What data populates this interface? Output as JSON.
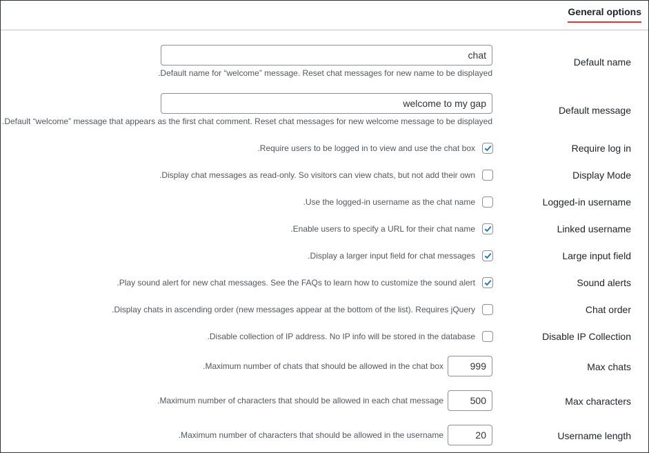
{
  "tabs": {
    "active_label": "General options"
  },
  "fields": {
    "default_name": {
      "label": "Default name",
      "value": "chat",
      "description": ".Default name for “welcome” message. Reset chat messages for new name to be displayed"
    },
    "default_message": {
      "label": "Default message",
      "value": "welcome to my gap",
      "description": ".Default “welcome” message that appears as the first chat comment. Reset chat messages for new welcome message to be displayed"
    },
    "require_login": {
      "label": "Require log in",
      "checked": true,
      "description": ".Require users to be logged in to view and use the chat box"
    },
    "display_mode": {
      "label": "Display Mode",
      "checked": false,
      "description": ".Display chat messages as read-only. So visitors can view chats, but not add their own"
    },
    "loggedin_username": {
      "label": "Logged-in username",
      "checked": false,
      "description": ".Use the logged-in username as the chat name"
    },
    "linked_username": {
      "label": "Linked username",
      "checked": true,
      "description": ".Enable users to specify a URL for their chat name"
    },
    "large_input": {
      "label": "Large input field",
      "checked": true,
      "description": ".Display a larger input field for chat messages"
    },
    "sound_alerts": {
      "label": "Sound alerts",
      "checked": true,
      "description": ".Play sound alert for new chat messages. See the FAQs to learn how to customize the sound alert"
    },
    "chat_order": {
      "label": "Chat order",
      "checked": false,
      "description": ".Display chats in ascending order (new messages appear at the bottom of the list). Requires jQuery"
    },
    "disable_ip": {
      "label": "Disable IP Collection",
      "checked": false,
      "description": ".Disable collection of IP address. No IP info will be stored in the database"
    },
    "max_chats": {
      "label": "Max chats",
      "value": "999",
      "description": ".Maximum number of chats that should be allowed in the chat box"
    },
    "max_characters": {
      "label": "Max characters",
      "value": "500",
      "description": ".Maximum number of characters that should be allowed in each chat message"
    },
    "username_length": {
      "label": "Username length",
      "value": "20",
      "description": ".Maximum number of characters that should be allowed in the username"
    }
  },
  "colors": {
    "accent": "#2271b1",
    "tab_underline": "#d63638",
    "border": "#8c8f94"
  }
}
